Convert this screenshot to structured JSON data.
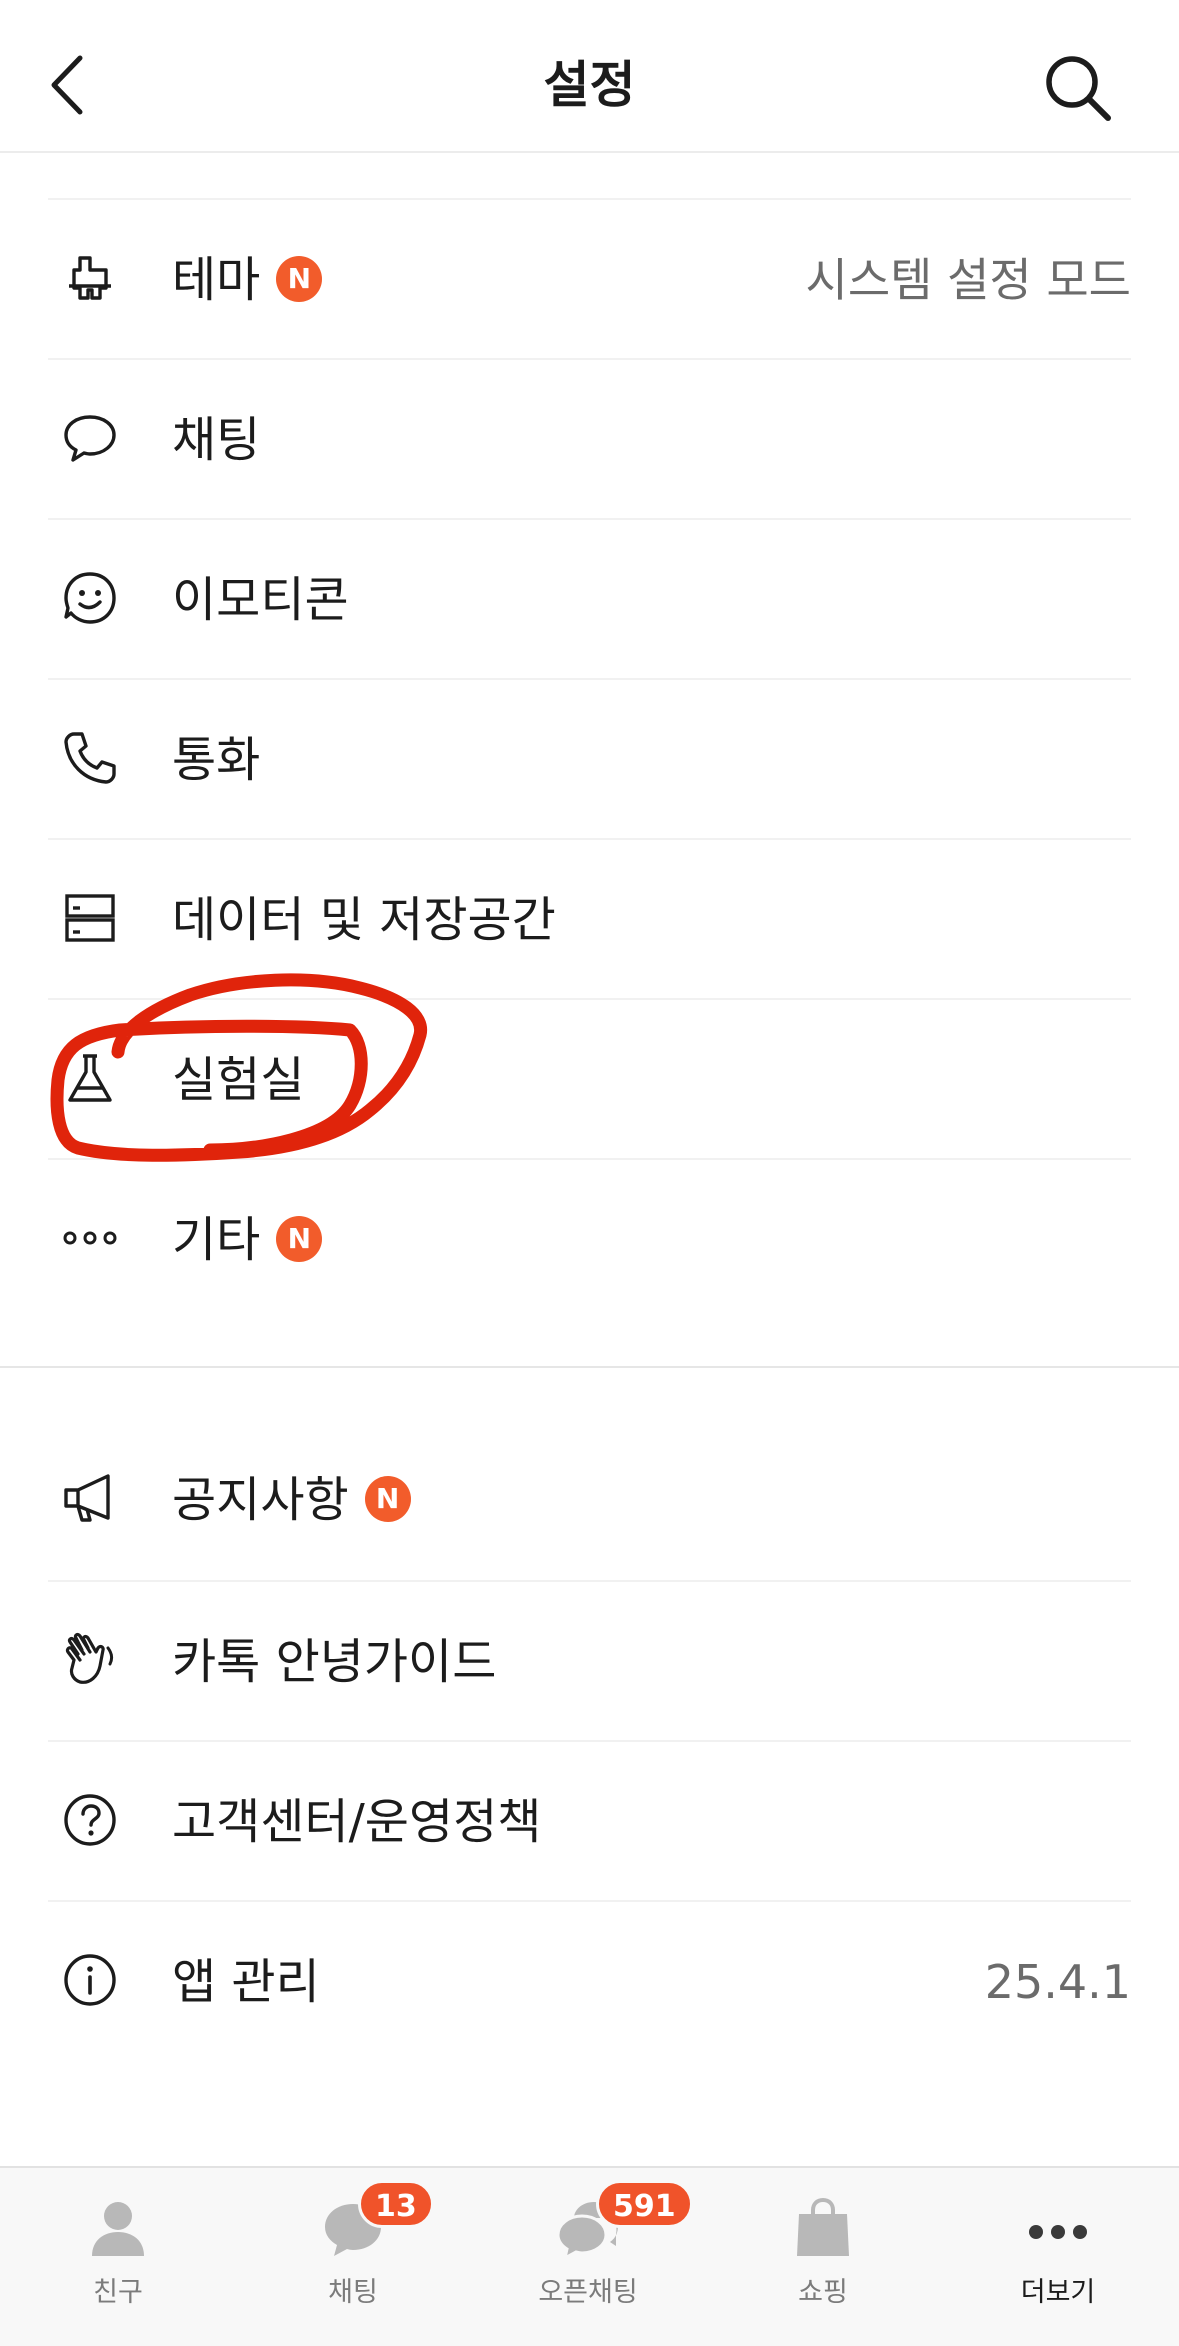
{
  "header": {
    "title": "설정"
  },
  "settings_group_1": [
    {
      "id": "theme",
      "label": "테마",
      "badge": "N",
      "value": "시스템 설정 모드",
      "icon": "brush-icon"
    },
    {
      "id": "chat",
      "label": "채팅",
      "icon": "speech-bubble-icon"
    },
    {
      "id": "emoticon",
      "label": "이모티콘",
      "icon": "smiley-icon"
    },
    {
      "id": "call",
      "label": "통화",
      "icon": "phone-icon"
    },
    {
      "id": "data",
      "label": "데이터 및 저장공간",
      "icon": "storage-icon"
    },
    {
      "id": "lab",
      "label": "실험실",
      "icon": "flask-icon"
    },
    {
      "id": "etc",
      "label": "기타",
      "badge": "N",
      "icon": "more-dots-icon"
    }
  ],
  "settings_group_2": [
    {
      "id": "notice",
      "label": "공지사항",
      "badge": "N",
      "icon": "megaphone-icon"
    },
    {
      "id": "guide",
      "label": "카톡 안녕가이드",
      "icon": "waving-hand-icon"
    },
    {
      "id": "support",
      "label": "고객센터/운영정책",
      "icon": "question-circle-icon"
    },
    {
      "id": "app",
      "label": "앱 관리",
      "value": "25.4.1",
      "icon": "info-circle-icon"
    }
  ],
  "annotation": {
    "color": "#e0240b",
    "target": "lab"
  },
  "tabbar": {
    "tabs": [
      {
        "label": "친구",
        "icon": "person-icon"
      },
      {
        "label": "채팅",
        "icon": "chat-bubble-icon",
        "count": "13"
      },
      {
        "label": "오픈채팅",
        "icon": "open-chat-icon",
        "count": "591"
      },
      {
        "label": "쇼핑",
        "icon": "shopping-bag-icon"
      },
      {
        "label": "더보기",
        "icon": "more-icon",
        "active": true
      }
    ]
  },
  "colors": {
    "badge": "#f25c2b",
    "text": "#1c1c1c",
    "secondary_text": "#6b6b6b",
    "tab_inactive": "#b5b5b5"
  }
}
